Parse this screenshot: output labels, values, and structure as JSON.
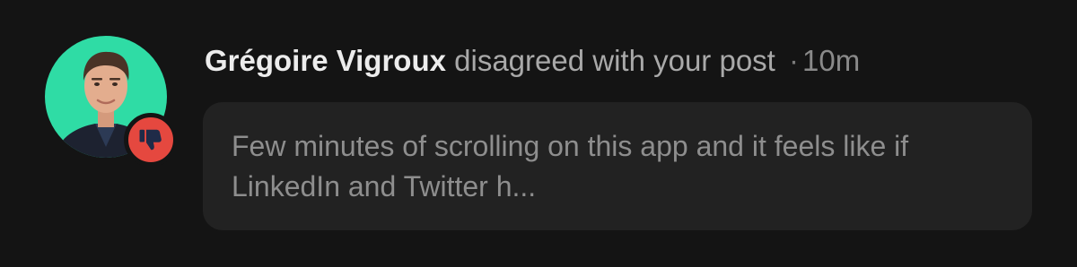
{
  "notification": {
    "actor_name": "Grégoire Vigroux",
    "action": "disagreed with your post",
    "separator": "·",
    "time": "10m",
    "reaction_icon": "thumbs-down-icon",
    "reaction_color": "#e5483f",
    "avatar_bg_color": "#2fdca5",
    "post_preview_line1": "Few minutes of scrolling on this app and it feels like if",
    "post_preview_line2": "LinkedIn and Twitter h..."
  }
}
